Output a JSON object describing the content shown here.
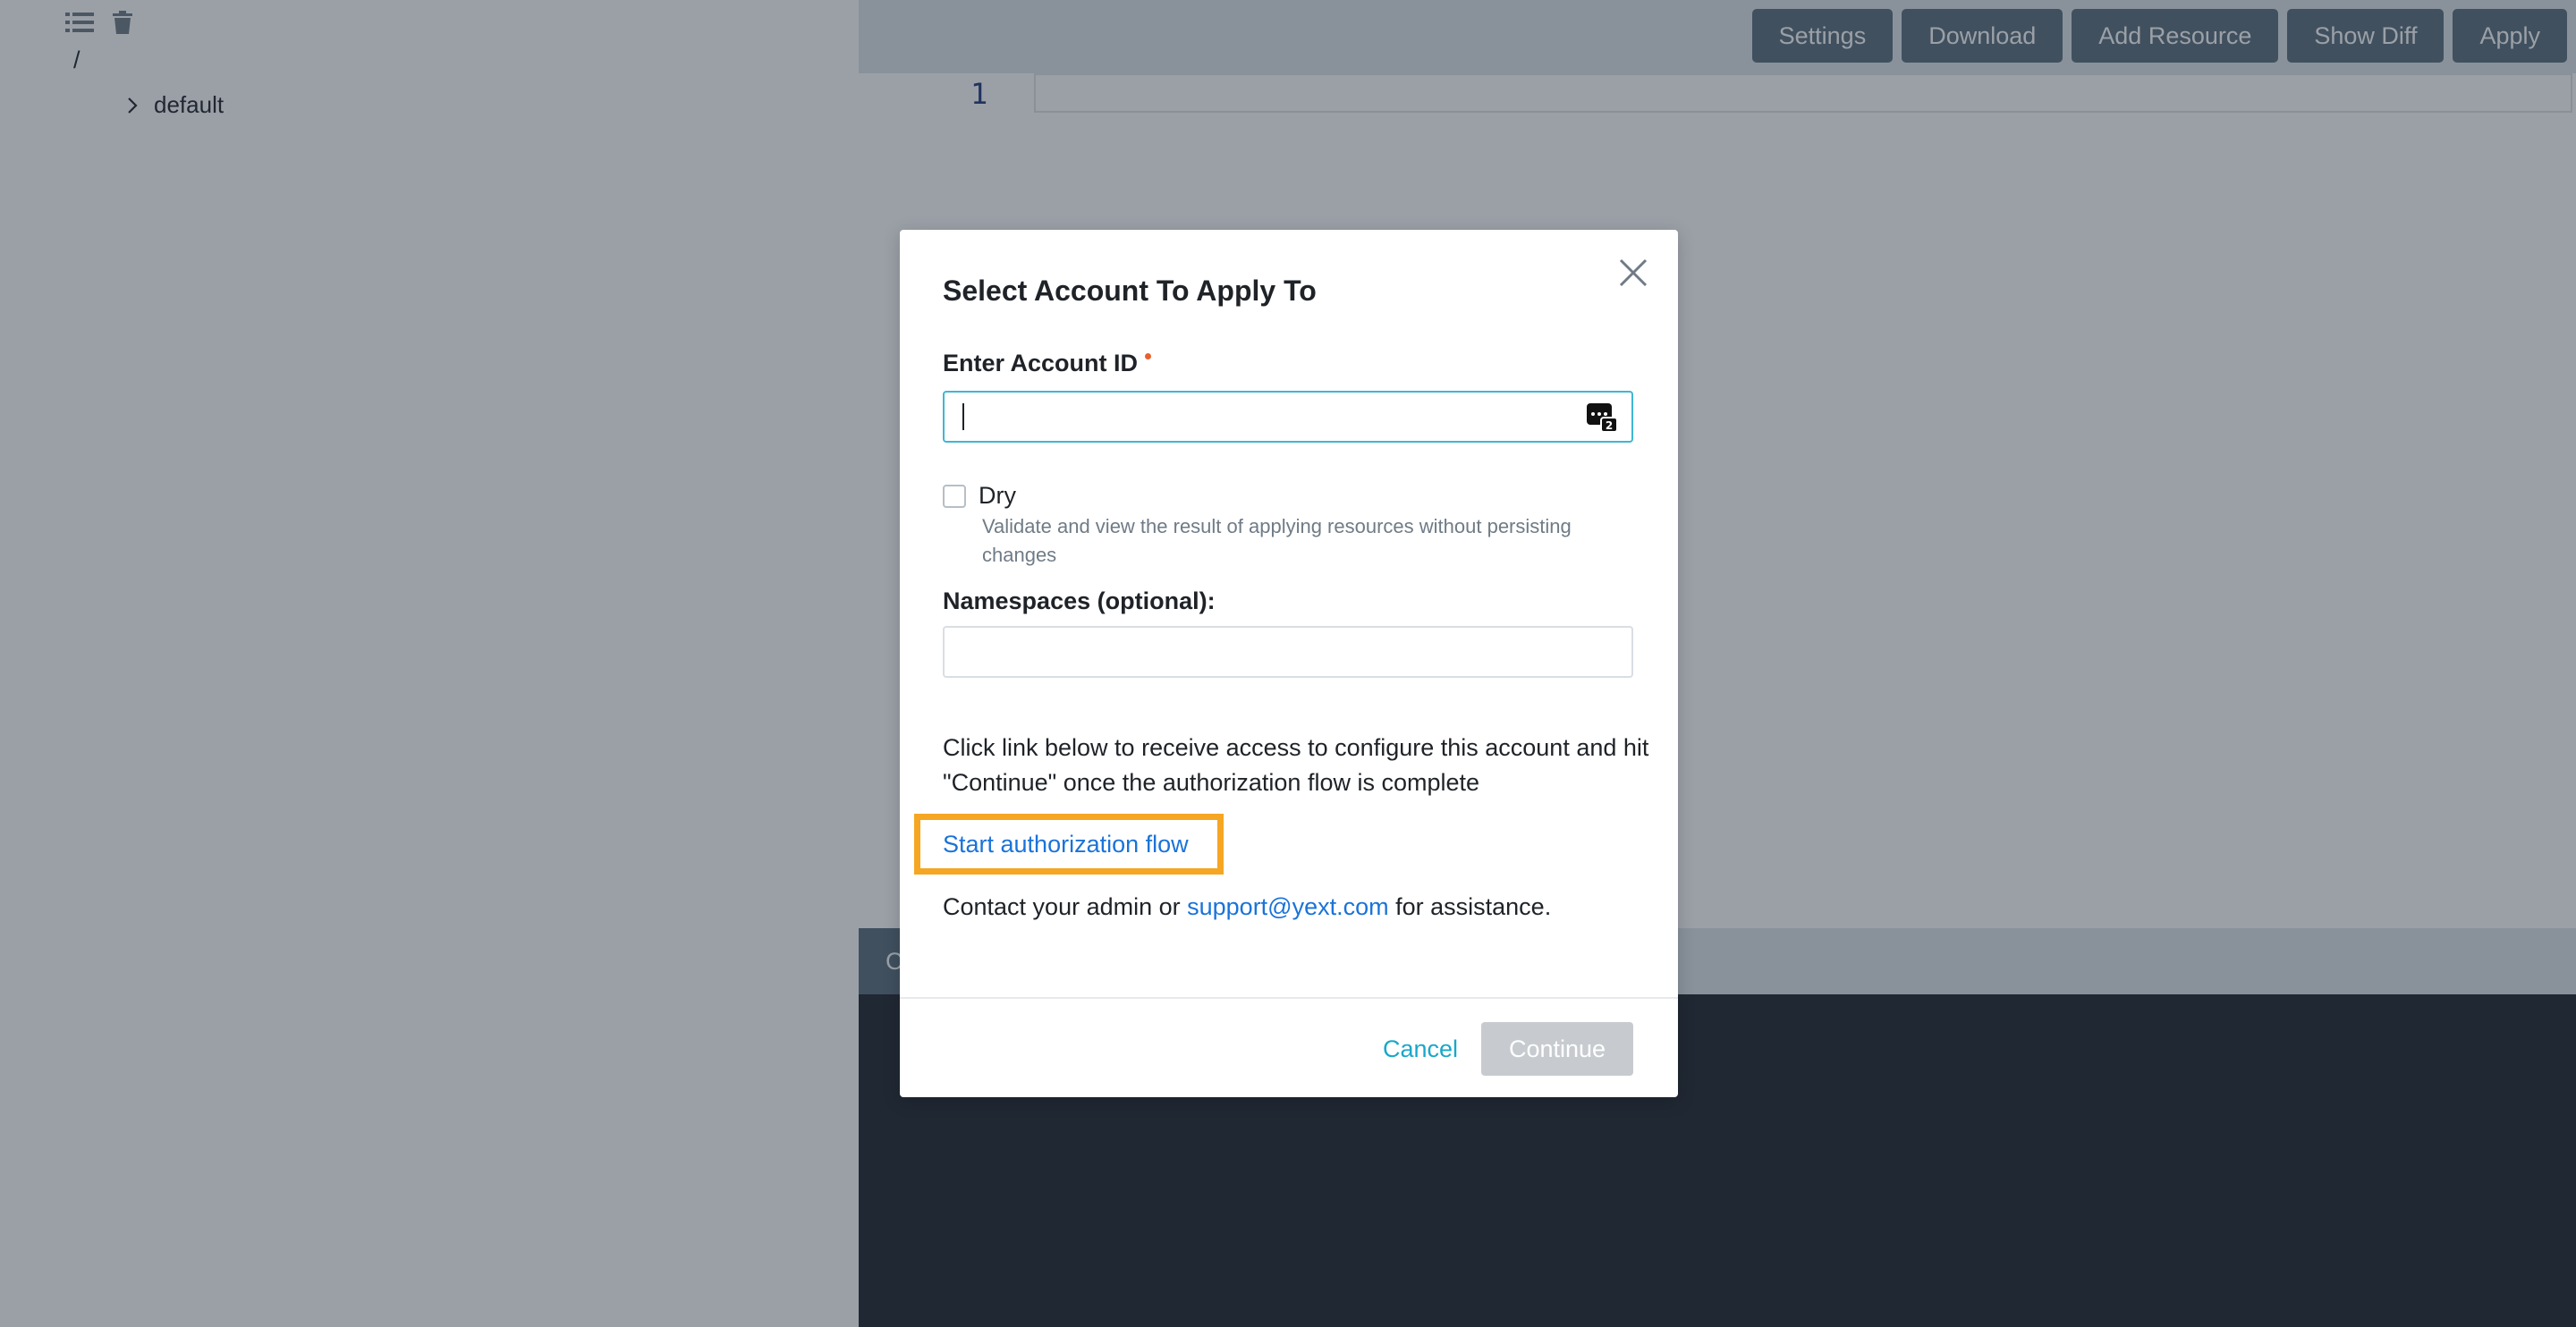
{
  "tree": {
    "toolbar_icons": [
      "list-icon",
      "trash-icon"
    ],
    "root_label": "/",
    "items": [
      {
        "label": "default",
        "icon": "chevron-right-icon"
      }
    ]
  },
  "toolbar": {
    "settings_label": "Settings",
    "download_label": "Download",
    "add_resource_label": "Add Resource",
    "show_diff_label": "Show Diff",
    "apply_label": "Apply"
  },
  "editor": {
    "line_numbers": [
      "1"
    ]
  },
  "console": {
    "tab_label": "C"
  },
  "modal": {
    "title": "Select Account To Apply To",
    "account_label": "Enter Account ID",
    "account_value": "",
    "dry_label": "Dry",
    "dry_help": "Validate and view the result of applying resources without persisting changes",
    "namespaces_label": "Namespaces (optional):",
    "namespaces_value": "",
    "info_text": "Click link below to receive access to configure this account and hit \"Continue\" once the authorization flow is complete",
    "auth_link_label": "Start authorization flow",
    "contact_prefix": "Contact your admin or ",
    "contact_email": "support@yext.com",
    "contact_suffix": " for assistance.",
    "cancel_label": "Cancel",
    "continue_label": "Continue"
  },
  "colors": {
    "toolbar_button": "#5a6d7d",
    "focus_border": "#3fb6d4",
    "link": "#1a73d9",
    "highlight": "#f5a623",
    "required": "#e8612c",
    "cancel": "#1aa7c9",
    "console_bg": "#1f252c"
  }
}
